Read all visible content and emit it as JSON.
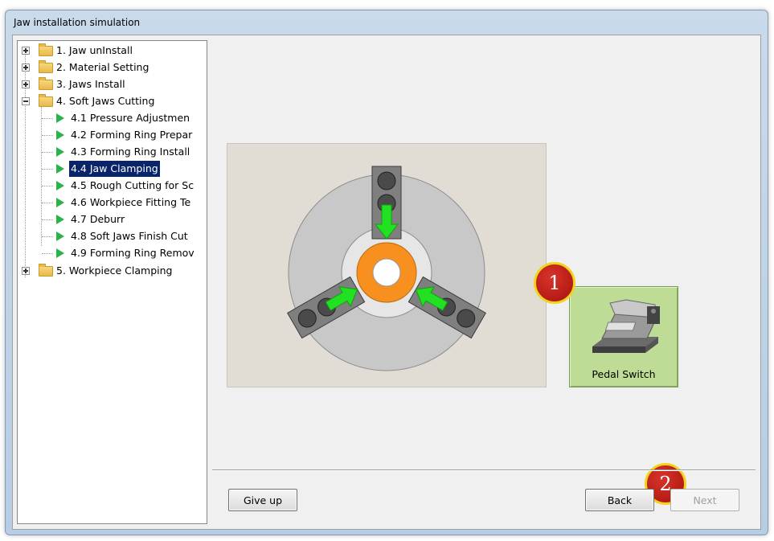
{
  "window": {
    "title": "Jaw installation simulation"
  },
  "tree": {
    "items": [
      {
        "label": "1. Jaw unInstall",
        "type": "folder",
        "expander": "plus"
      },
      {
        "label": "2. Material Setting",
        "type": "folder",
        "expander": "plus"
      },
      {
        "label": "3. Jaws Install",
        "type": "folder",
        "expander": "plus"
      },
      {
        "label": "4. Soft Jaws Cutting",
        "type": "folder",
        "expander": "minus"
      },
      {
        "label": "4.1 Pressure Adjustmen",
        "type": "step"
      },
      {
        "label": "4.2 Forming Ring Prepar",
        "type": "step"
      },
      {
        "label": "4.3 Forming Ring Install",
        "type": "step"
      },
      {
        "label": "4.4 Jaw Clamping",
        "type": "step",
        "selected": true
      },
      {
        "label": "4.5 Rough Cutting for Sc",
        "type": "step"
      },
      {
        "label": "4.6 Workpiece Fitting Te",
        "type": "step"
      },
      {
        "label": "4.7 Deburr",
        "type": "step"
      },
      {
        "label": "4.8 Soft Jaws Finish Cut",
        "type": "step"
      },
      {
        "label": "4.9 Forming Ring Remov",
        "type": "step"
      },
      {
        "label": "5. Workpiece Clamping",
        "type": "folder",
        "expander": "plus"
      }
    ]
  },
  "pedal": {
    "label": "Pedal Switch"
  },
  "badges": {
    "first": "1",
    "second": "2"
  },
  "buttons": {
    "give_up": "Give up",
    "back": "Back",
    "next": "Next"
  },
  "colors": {
    "chuck": "#c8c8c8",
    "jaw": "#7f7f7f",
    "arrow": "#22e022",
    "workpiece": "#f7901e",
    "pedal_bg": "#bedc96",
    "badge": "#c0201a",
    "selection": "#0a246a"
  }
}
